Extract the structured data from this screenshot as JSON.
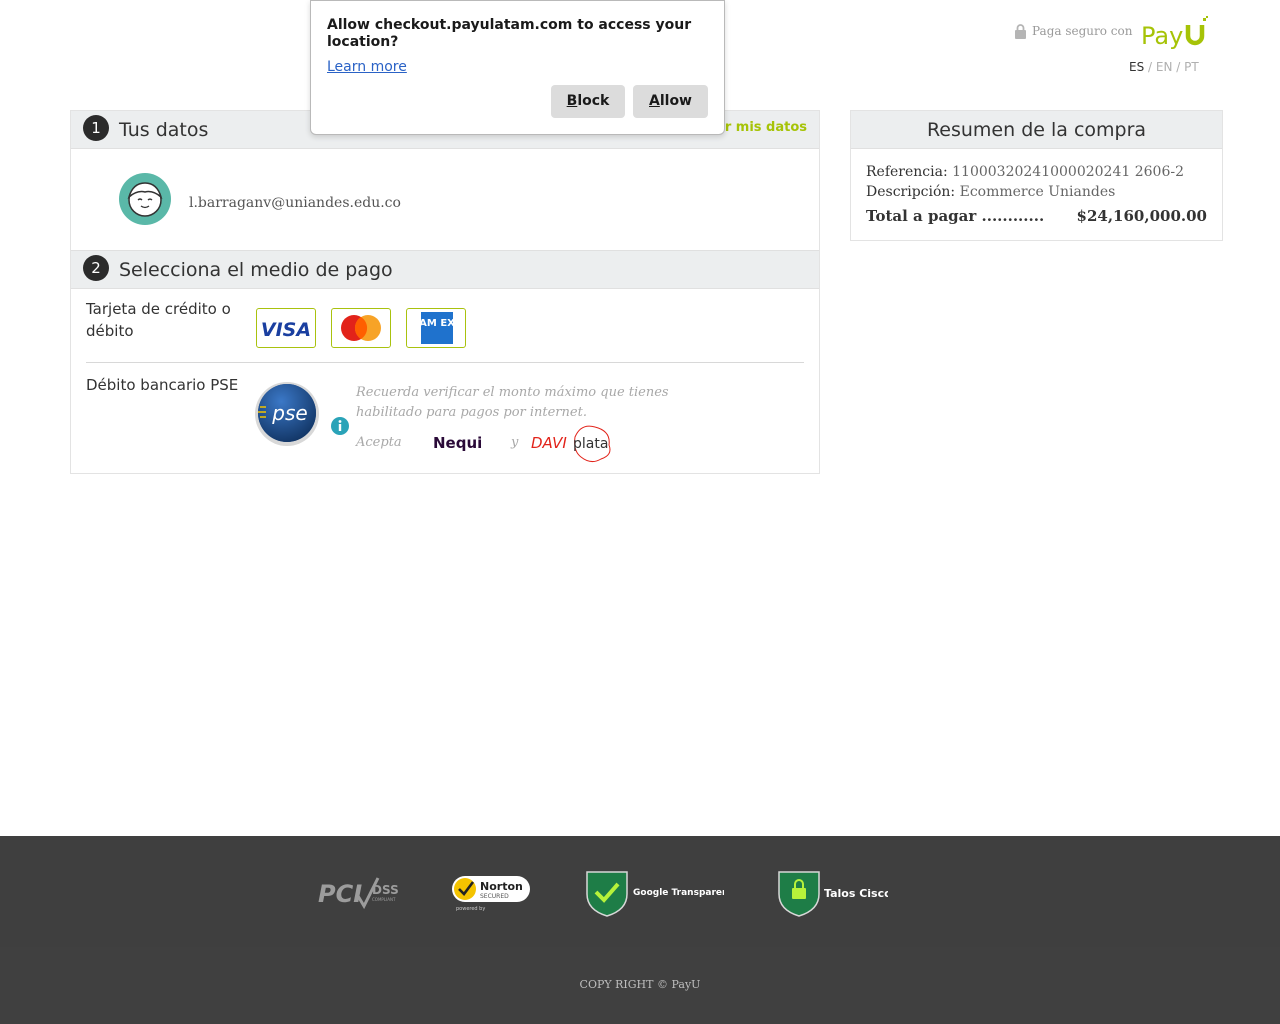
{
  "header": {
    "secure_text": "Paga seguro con",
    "brand": "PayU",
    "languages": [
      "ES",
      "EN",
      "PT"
    ],
    "active_language": "ES",
    "lang_sep": "/"
  },
  "dialog": {
    "message": "Allow checkout.payulatam.com to access your location?",
    "learn_more": "Learn more",
    "block_first": "B",
    "block_rest": "lock",
    "allow_first": "A",
    "allow_rest": "llow"
  },
  "step1": {
    "number": "1",
    "title": "Tus datos",
    "edit_link": "Editar mis datos",
    "email": "l.barraganv@uniandes.edu.co"
  },
  "step2": {
    "number": "2",
    "title": "Selecciona el medio de pago",
    "card_label": "Tarjeta de crédito o débito",
    "cards": [
      "visa",
      "mastercard",
      "amex"
    ],
    "visa_text": "VISA",
    "amex_text": "AM EX",
    "pse_label": "Débito bancario PSE",
    "pse_logo_text": "pse",
    "pse_note": "Recuerda verificar el monto máximo que tienes habilitado para pagos por internet.",
    "acepta": "Acepta",
    "nequi": "Nequi",
    "y": "y",
    "davi_text": "DAVI",
    "plata_text": "plata"
  },
  "summary": {
    "title": "Resumen de la compra",
    "ref_label": "Referencia:",
    "ref_value": "11000320241000020241 2606-2",
    "desc_label": "Descripción:",
    "desc_value": "Ecommerce Uniandes",
    "total_label": "Total a pagar ............",
    "total_value": "$24,160,000.00"
  },
  "footer": {
    "badges": [
      "PCI DSS COMPLIANT",
      "Norton SECURED",
      "Google Transparency",
      "Talos Cisco"
    ],
    "pci": "PCI",
    "dss": "DSS",
    "compliant": "COMPLIANT",
    "norton": "Norton",
    "secured": "SECURED",
    "powered": "powered by",
    "google": "Google Transparency",
    "talos": "Talos Cisco",
    "copyright": "COPY RIGHT © PayU"
  },
  "colors": {
    "accent_green": "#a6c307",
    "dark_badge": "#2b2b2b",
    "footer_bg": "#3f3f3f",
    "link_blue": "#2a62c6"
  }
}
